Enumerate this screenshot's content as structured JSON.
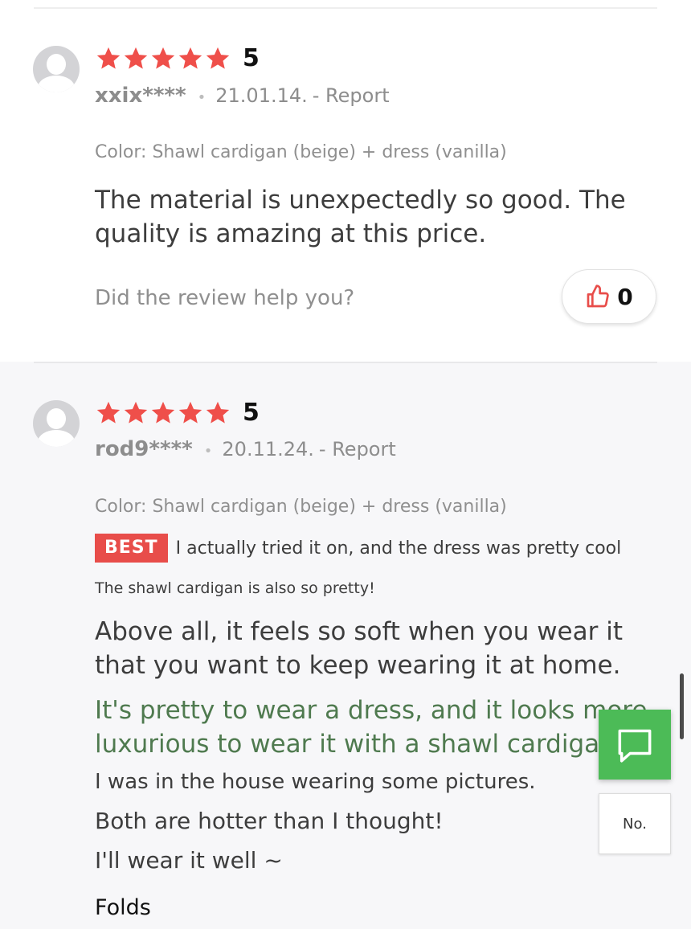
{
  "reviews": [
    {
      "rating": "5",
      "stars": 5,
      "username": "xxix****",
      "date": "21.01.14.",
      "report": "- Report",
      "color_option": "Color: Shawl cardigan (beige) + dress (vanilla)",
      "body": "The material is unexpectedly so good. The quality is amazing at this price.",
      "help_question": "Did the review help you?",
      "like_count": "0"
    },
    {
      "rating": "5",
      "stars": 5,
      "username": "rod9****",
      "date": "20.11.24.",
      "report": "- Report",
      "color_option": "Color: Shawl cardigan (beige) + dress (vanilla)",
      "best_badge": "BEST",
      "best_text": "I actually tried it on, and the dress was pretty cool",
      "small_line": "The shawl cardigan is also so pretty!",
      "body": "Above all, it feels so soft when you wear it that you want to keep wearing it at home.",
      "green_text": "It's pretty to wear a dress, and it looks more luxurious to wear it with a shawl cardigan!",
      "line1": "I was in the house wearing some pictures.",
      "line2": "Both are hotter than I thought!",
      "line3": "I'll wear it well ~",
      "folds": "Folds"
    }
  ],
  "floating": {
    "translate_label": "No.",
    "chat_icon": "chat-bubble-icon"
  },
  "colors": {
    "star": "#ef4f4a",
    "best_badge": "#e84d4a",
    "chat_button": "#4cbb57",
    "highlight_text": "#4f7a4f"
  }
}
